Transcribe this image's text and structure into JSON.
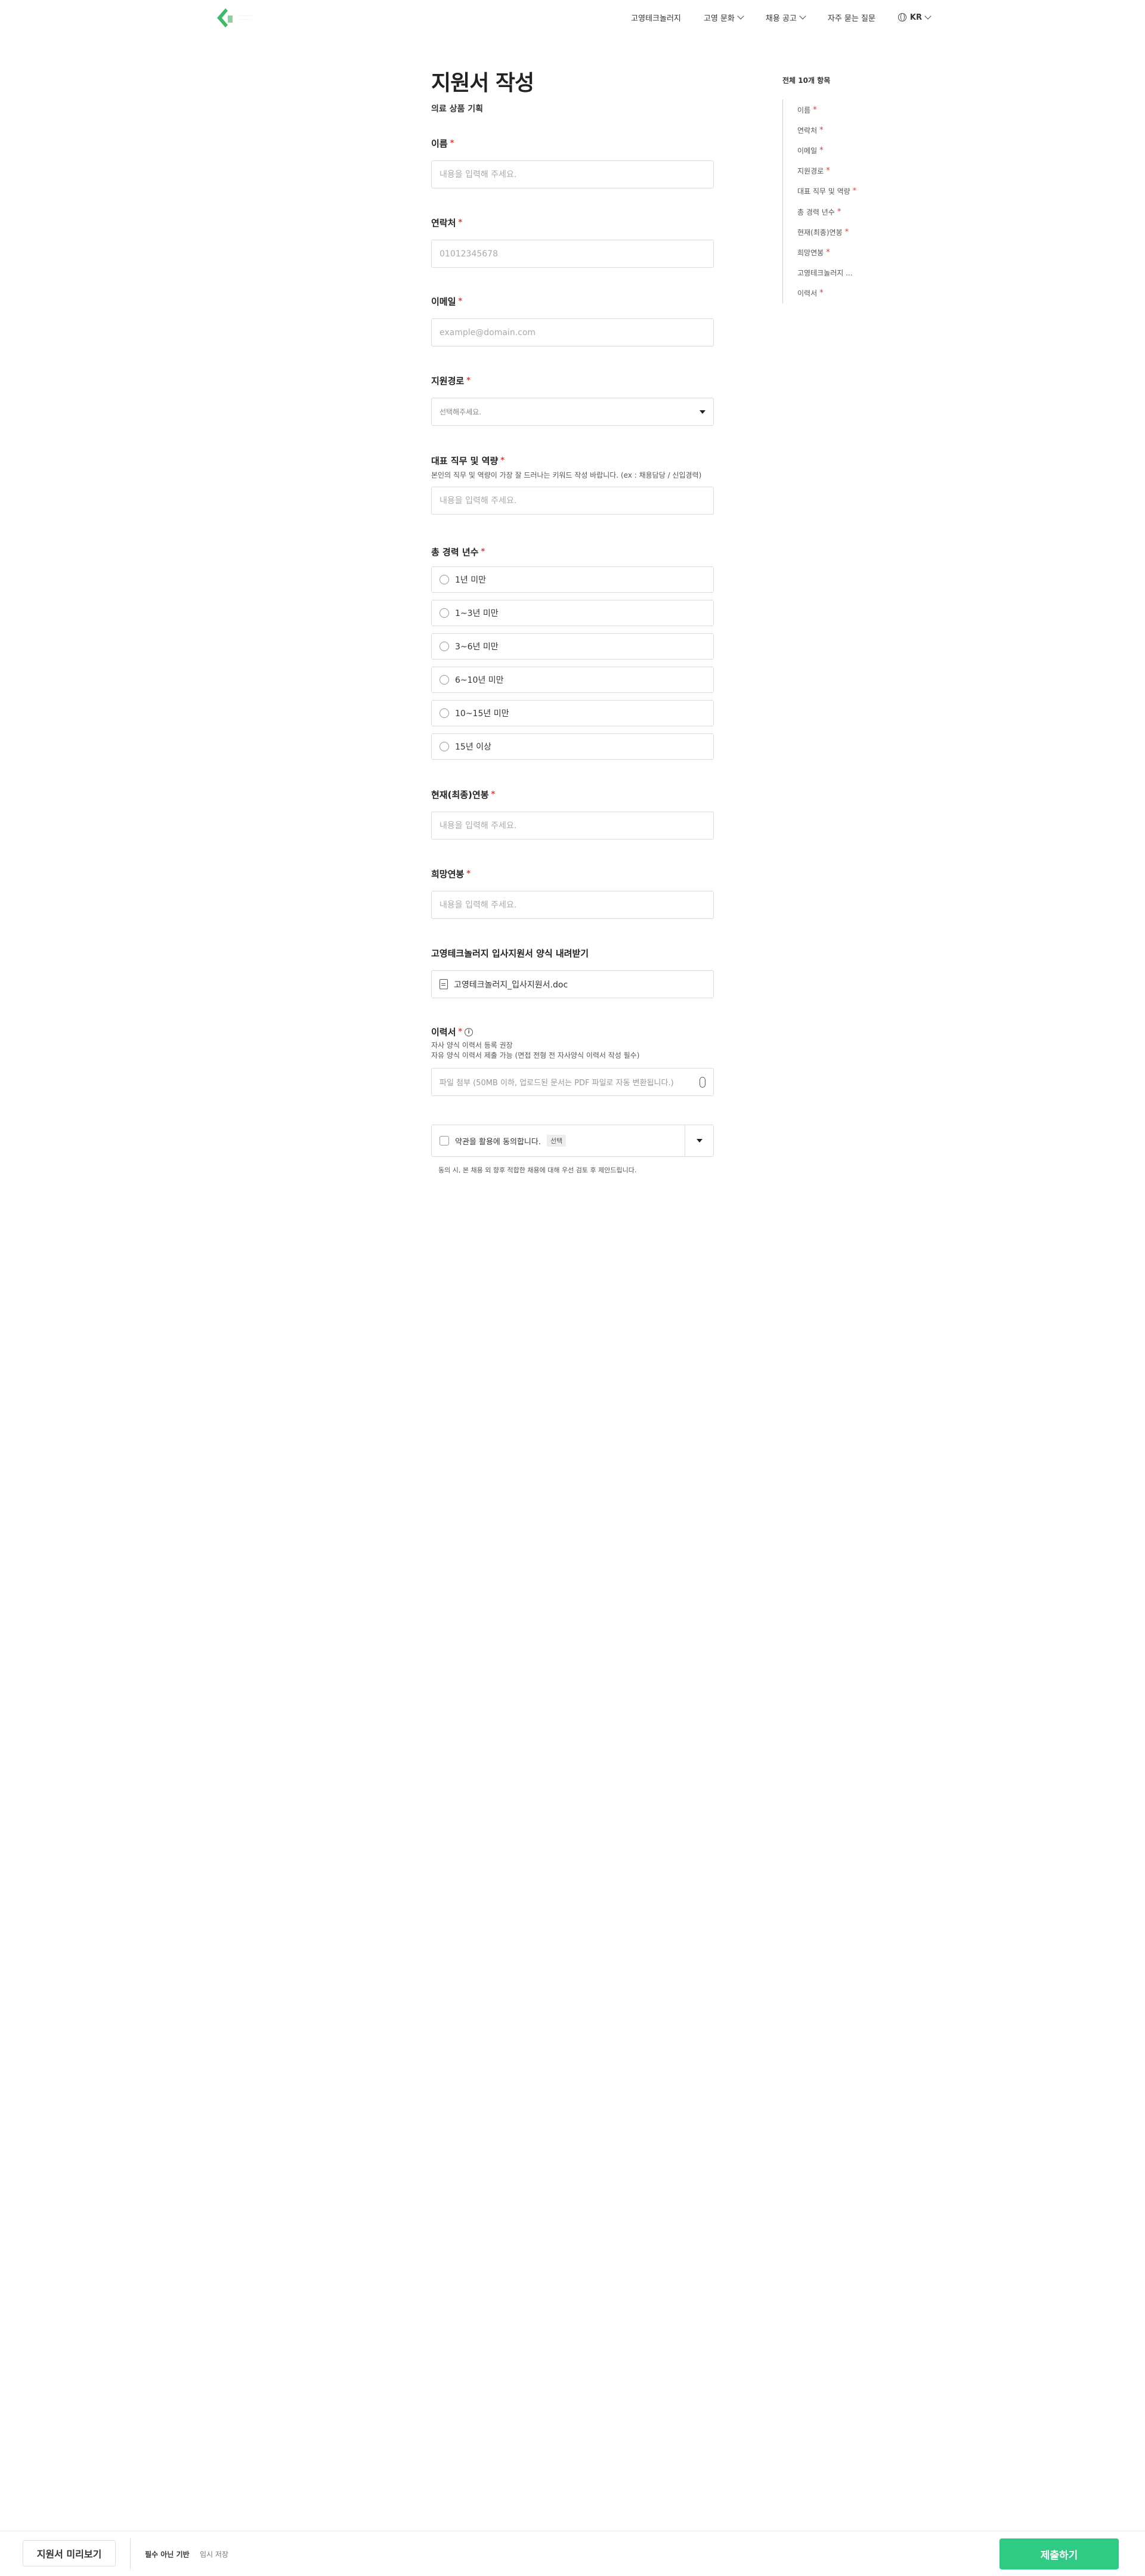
{
  "nav": {
    "items": [
      "고영테크놀러지",
      "고영 문화",
      "채용 공고",
      "자주 묻는 질문"
    ],
    "language": "KR"
  },
  "form": {
    "title": "지원서 작성",
    "subtitle": "의료 상품 기획",
    "name": {
      "label": "이름",
      "placeholder": "내용을 입력해 주세요."
    },
    "phone": {
      "label": "연락처",
      "placeholder": "01012345678"
    },
    "email": {
      "label": "이메일",
      "placeholder": "example@domain.com"
    },
    "source": {
      "label": "지원경로",
      "placeholder": "선택해주세요."
    },
    "role": {
      "label": "대표 직무 및 역량",
      "hint": "본인의 직무 및 역량이 가장 잘 드러나는 키워드 작성 바랍니다. (ex : 채용담당 / 신입경력)",
      "placeholder": "내용을 입력해 주세요."
    },
    "career": {
      "label": "총 경력 년수",
      "options": [
        "1년 미만",
        "1~3년 미만",
        "3~6년 미만",
        "6~10년 미만",
        "10~15년 미만",
        "15년 이상"
      ]
    },
    "current_salary": {
      "label": "현재(최종)연봉",
      "placeholder": "내용을 입력해 주세요."
    },
    "desired_salary": {
      "label": "희망연봉",
      "placeholder": "내용을 입력해 주세요."
    },
    "download": {
      "label": "고영테크놀러지 입사지원서 양식 내려받기",
      "filename": "고영테크놀러지_입사지원서.doc"
    },
    "resume": {
      "label": "이력서",
      "hint1": "자사 양식 이력서 등록 권장",
      "hint2": "자유 양식 이력서 제출 가능 (면접 전형 전 자사양식 이력서 작성 필수)",
      "placeholder": "파일 첨부 (50MB 이하, 업로드된 문서는 PDF 파일로 자동 변환됩니다.)"
    },
    "consent": {
      "label": "약관을 활용에 동의합니다.",
      "badge": "선택",
      "note": "동의 시, 본 채용 외 향후 적합한 채용에 대해 우선 검토 후 제안드립니다."
    }
  },
  "toc": {
    "title": "전체 10개 항목",
    "items": [
      {
        "label": "이름",
        "required": true
      },
      {
        "label": "연락처",
        "required": true
      },
      {
        "label": "이메일",
        "required": true
      },
      {
        "label": "지원경로",
        "required": true
      },
      {
        "label": "대표 직무 및 역량",
        "required": true
      },
      {
        "label": "총 경력 년수",
        "required": true
      },
      {
        "label": "현재(최종)연봉",
        "required": true
      },
      {
        "label": "희망연봉",
        "required": true
      },
      {
        "label": "고영테크놀러지 ...",
        "required": false
      },
      {
        "label": "이력서",
        "required": true
      }
    ]
  },
  "bottombar": {
    "preview": "지원서 미리보기",
    "required_note": "필수 아닌 기반",
    "save_note": "임시 저장",
    "submit": "제출하기"
  },
  "colors": {
    "accent": "#2fcb82",
    "required": "#e23b3b"
  }
}
